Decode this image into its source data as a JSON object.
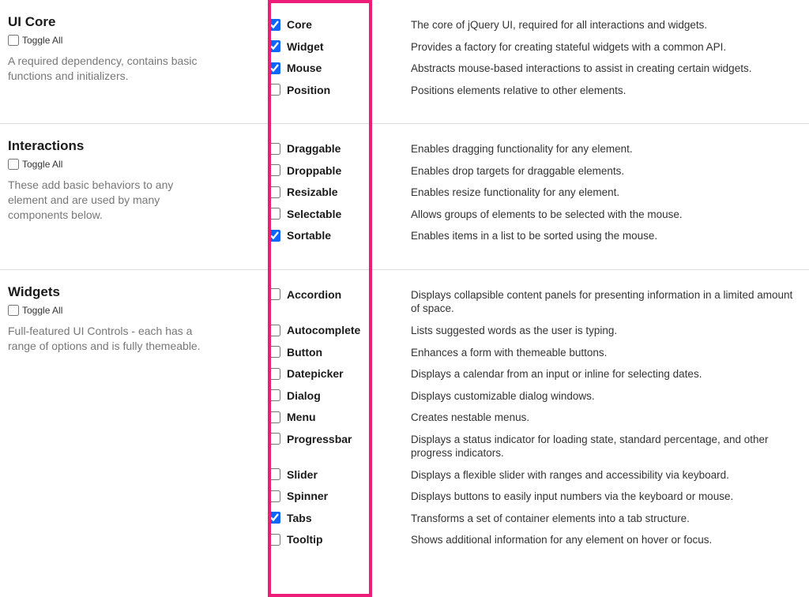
{
  "sections": [
    {
      "id": "ui-core",
      "title": "UI Core",
      "toggle_label": "Toggle All",
      "desc": "A required dependency, contains basic functions and initializers.",
      "items": [
        {
          "name": "Core",
          "checked": true,
          "desc": "The core of jQuery UI, required for all interactions and widgets."
        },
        {
          "name": "Widget",
          "checked": true,
          "desc": "Provides a factory for creating stateful widgets with a common API."
        },
        {
          "name": "Mouse",
          "checked": true,
          "desc": "Abstracts mouse-based interactions to assist in creating certain widgets."
        },
        {
          "name": "Position",
          "checked": false,
          "desc": "Positions elements relative to other elements."
        }
      ]
    },
    {
      "id": "interactions",
      "title": "Interactions",
      "toggle_label": "Toggle All",
      "desc": "These add basic behaviors to any element and are used by many components below.",
      "items": [
        {
          "name": "Draggable",
          "checked": false,
          "desc": "Enables dragging functionality for any element."
        },
        {
          "name": "Droppable",
          "checked": false,
          "desc": "Enables drop targets for draggable elements."
        },
        {
          "name": "Resizable",
          "checked": false,
          "desc": "Enables resize functionality for any element."
        },
        {
          "name": "Selectable",
          "checked": false,
          "desc": "Allows groups of elements to be selected with the mouse."
        },
        {
          "name": "Sortable",
          "checked": true,
          "desc": "Enables items in a list to be sorted using the mouse."
        }
      ]
    },
    {
      "id": "widgets",
      "title": "Widgets",
      "toggle_label": "Toggle All",
      "desc": "Full-featured UI Controls - each has a range of options and is fully themeable.",
      "items": [
        {
          "name": "Accordion",
          "checked": false,
          "desc": "Displays collapsible content panels for presenting information in a limited amount of space."
        },
        {
          "name": "Autocomplete",
          "checked": false,
          "desc": "Lists suggested words as the user is typing."
        },
        {
          "name": "Button",
          "checked": false,
          "desc": "Enhances a form with themeable buttons."
        },
        {
          "name": "Datepicker",
          "checked": false,
          "desc": "Displays a calendar from an input or inline for selecting dates."
        },
        {
          "name": "Dialog",
          "checked": false,
          "desc": "Displays customizable dialog windows."
        },
        {
          "name": "Menu",
          "checked": false,
          "desc": "Creates nestable menus."
        },
        {
          "name": "Progressbar",
          "checked": false,
          "desc": "Displays a status indicator for loading state, standard percentage, and other progress indicators."
        },
        {
          "name": "Slider",
          "checked": false,
          "desc": "Displays a flexible slider with ranges and accessibility via keyboard."
        },
        {
          "name": "Spinner",
          "checked": false,
          "desc": "Displays buttons to easily input numbers via the keyboard or mouse."
        },
        {
          "name": "Tabs",
          "checked": true,
          "desc": "Transforms a set of container elements into a tab structure."
        },
        {
          "name": "Tooltip",
          "checked": false,
          "desc": "Shows additional information for any element on hover or focus."
        }
      ]
    }
  ]
}
